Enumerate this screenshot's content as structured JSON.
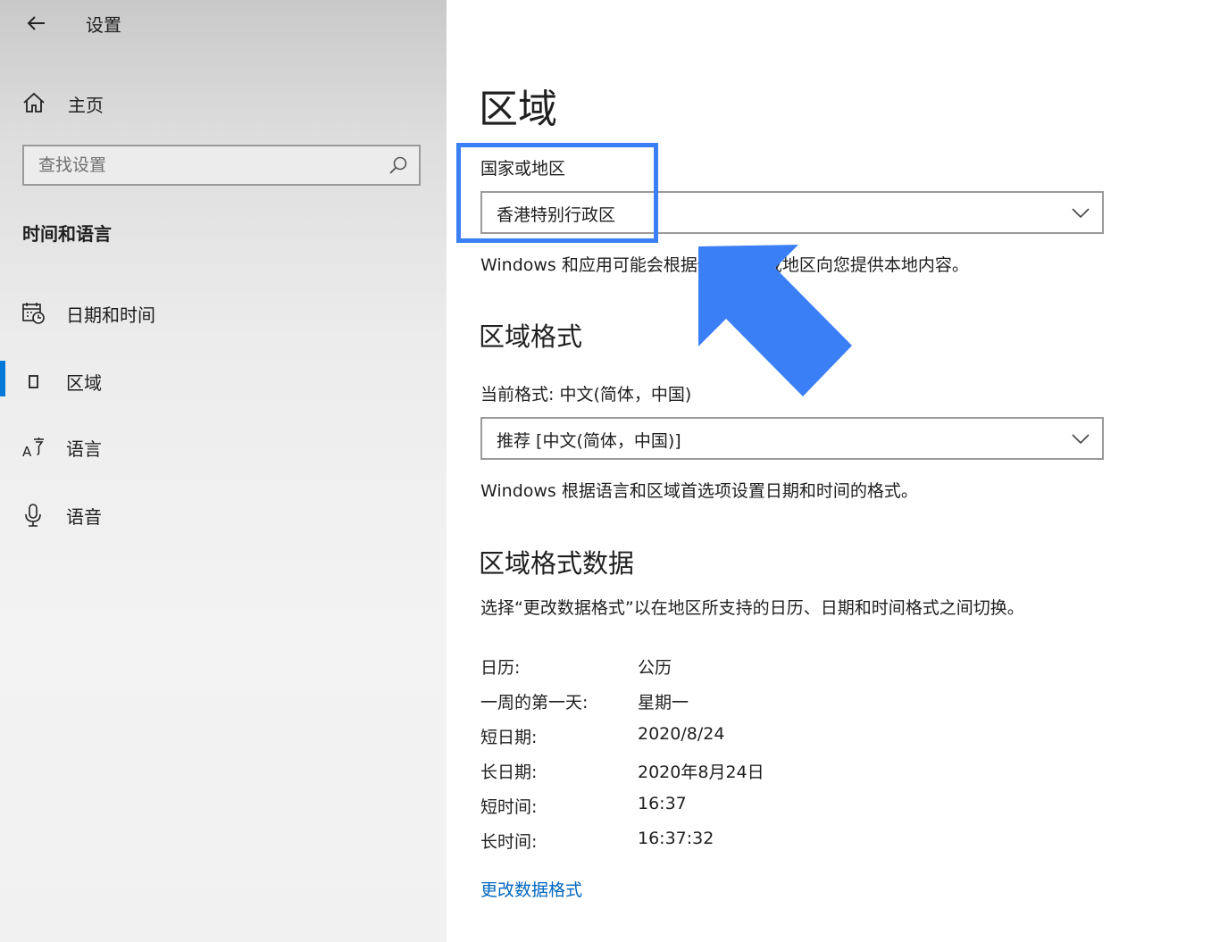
{
  "window": {
    "title": "设置"
  },
  "sidebar": {
    "home_label": "主页",
    "search_placeholder": "查找设置",
    "section_title": "时间和语言",
    "items": [
      {
        "label": "日期和时间",
        "icon": "calendar-clock-icon"
      },
      {
        "label": "区域",
        "icon": "region-icon"
      },
      {
        "label": "语言",
        "icon": "language-icon"
      },
      {
        "label": "语音",
        "icon": "microphone-icon"
      }
    ],
    "active_index": 1
  },
  "main": {
    "title": "区域",
    "country": {
      "label": "国家或地区",
      "value": "香港特别行政区",
      "desc": "Windows 和应用可能会根据你的国家或地区向您提供本地内容。"
    },
    "region_format": {
      "heading": "区域格式",
      "current_label": "当前格式: 中文(简体，中国)",
      "value": "推荐 [中文(简体，中国)]",
      "desc": "Windows 根据语言和区域首选项设置日期和时间的格式。"
    },
    "format_data": {
      "heading": "区域格式数据",
      "desc": "选择“更改数据格式”以在地区所支持的日历、日期和时间格式之间切换。",
      "rows": [
        {
          "key": "日历:",
          "value": "公历"
        },
        {
          "key": "一周的第一天:",
          "value": "星期一"
        },
        {
          "key": "短日期:",
          "value": "2020/8/24"
        },
        {
          "key": "长日期:",
          "value": "2020年8月24日"
        },
        {
          "key": "短时间:",
          "value": "16:37"
        },
        {
          "key": "长时间:",
          "value": "16:37:32"
        }
      ],
      "link": "更改数据格式"
    }
  },
  "colors": {
    "accent": "#0078d7",
    "link": "#0067c0",
    "annotation": "#3a7ff5"
  }
}
